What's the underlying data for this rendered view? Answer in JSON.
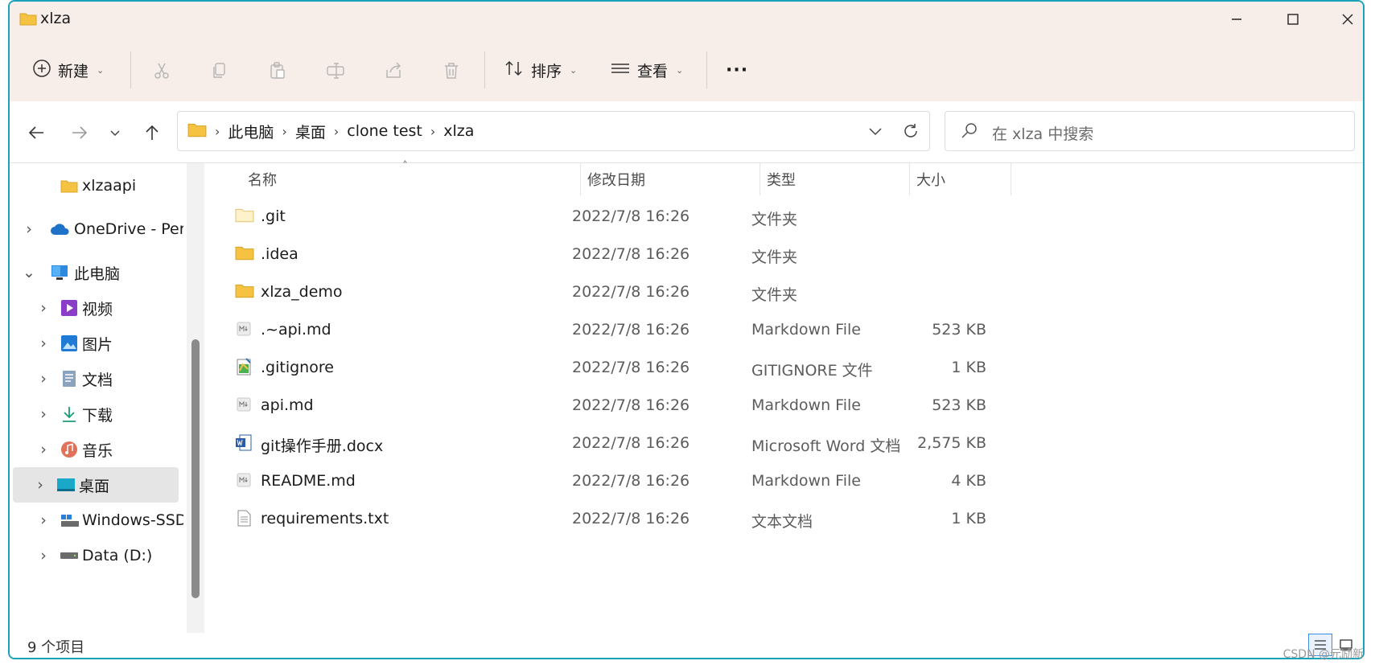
{
  "window": {
    "title": "xlza"
  },
  "toolbar": {
    "new_label": "新建",
    "sort_label": "排序",
    "view_label": "查看",
    "more_label": "···"
  },
  "address": {
    "crumbs": [
      "此电脑",
      "桌面",
      "clone test",
      "xlza"
    ]
  },
  "search": {
    "placeholder": "在 xlza 中搜索"
  },
  "sidebar": {
    "items": [
      {
        "label": "xlzaapi",
        "icon": "folder-icon"
      },
      {
        "label": "OneDrive - Pers",
        "icon": "onedrive-icon"
      },
      {
        "label": "此电脑",
        "icon": "pc-icon"
      },
      {
        "label": "视频",
        "icon": "video-icon"
      },
      {
        "label": "图片",
        "icon": "pictures-icon"
      },
      {
        "label": "文档",
        "icon": "documents-icon"
      },
      {
        "label": "下载",
        "icon": "download-icon"
      },
      {
        "label": "音乐",
        "icon": "music-icon"
      },
      {
        "label": "桌面",
        "icon": "desktop-icon"
      },
      {
        "label": "Windows-SSD",
        "icon": "drive-icon"
      },
      {
        "label": "Data (D:)",
        "icon": "drive-icon"
      }
    ]
  },
  "columns": {
    "name": "名称",
    "date": "修改日期",
    "type": "类型",
    "size": "大小"
  },
  "files": [
    {
      "name": ".git",
      "date": "2022/7/8 16:26",
      "type": "文件夹",
      "size": "",
      "icon": "folder-icon"
    },
    {
      "name": ".idea",
      "date": "2022/7/8 16:26",
      "type": "文件夹",
      "size": "",
      "icon": "folder-icon"
    },
    {
      "name": "xlza_demo",
      "date": "2022/7/8 16:26",
      "type": "文件夹",
      "size": "",
      "icon": "folder-icon"
    },
    {
      "name": ".~api.md",
      "date": "2022/7/8 16:26",
      "type": "Markdown File",
      "size": "523 KB",
      "icon": "markdown-icon"
    },
    {
      "name": ".gitignore",
      "date": "2022/7/8 16:26",
      "type": "GITIGNORE 文件",
      "size": "1 KB",
      "icon": "gitignore-icon"
    },
    {
      "name": "api.md",
      "date": "2022/7/8 16:26",
      "type": "Markdown File",
      "size": "523 KB",
      "icon": "markdown-icon"
    },
    {
      "name": "git操作手册.docx",
      "date": "2022/7/8 16:26",
      "type": "Microsoft Word 文档",
      "size": "2,575 KB",
      "icon": "word-icon"
    },
    {
      "name": "README.md",
      "date": "2022/7/8 16:26",
      "type": "Markdown File",
      "size": "4 KB",
      "icon": "markdown-icon"
    },
    {
      "name": "requirements.txt",
      "date": "2022/7/8 16:26",
      "type": "文本文档",
      "size": "1 KB",
      "icon": "text-file-icon"
    }
  ],
  "status": {
    "count": "9 个项目"
  },
  "watermark": "CSDN @元励新",
  "colors": {
    "accent": "#1aa3b8",
    "titlebar": "#f7ede9",
    "folder": "#f5c242",
    "selection": "#e5e5e5"
  }
}
